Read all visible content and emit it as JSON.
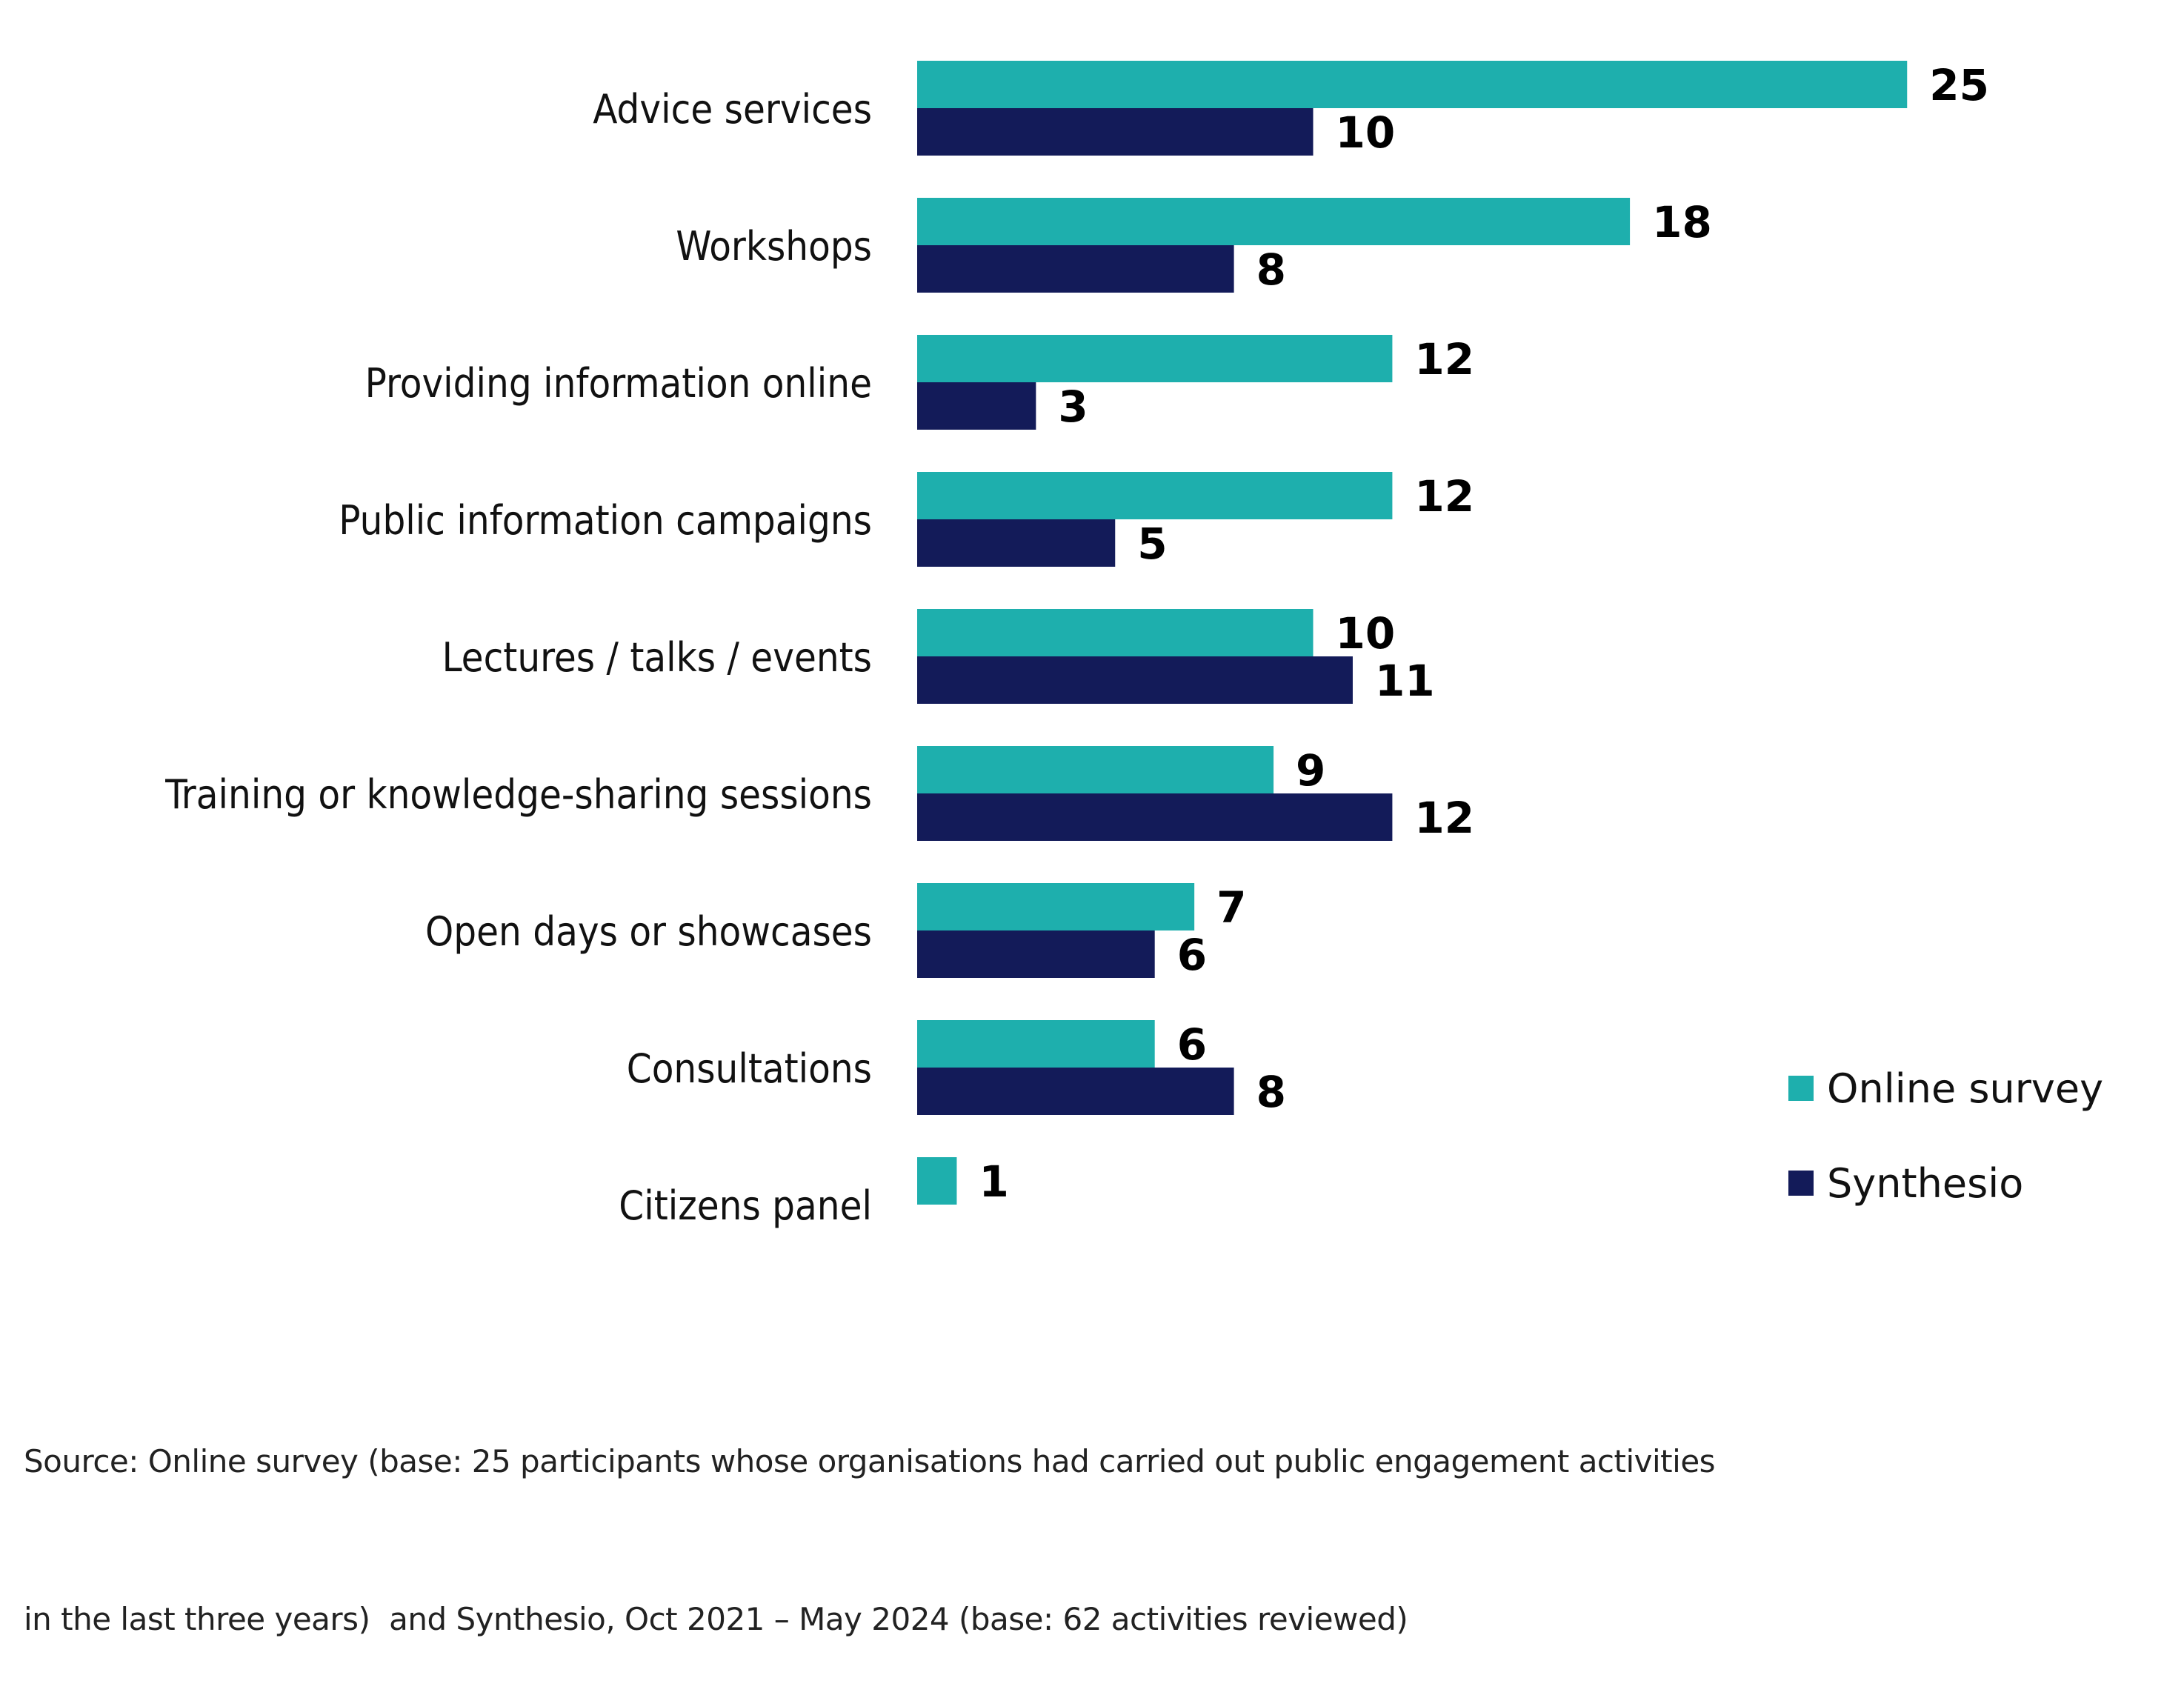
{
  "chart_data": {
    "type": "bar",
    "orientation": "horizontal",
    "title": "",
    "xlabel": "",
    "ylabel": "",
    "categories": [
      "Advice services",
      "Workshops",
      "Providing information online",
      "Public information campaigns",
      "Lectures / talks / events",
      "Training or knowledge-sharing sessions",
      "Open days or showcases",
      "Consultations",
      "Citizens panel"
    ],
    "series": [
      {
        "name": "Online survey",
        "color": "#1eafad",
        "values": [
          25,
          18,
          12,
          12,
          10,
          9,
          7,
          6,
          1
        ]
      },
      {
        "name": "Synthesio",
        "color": "#131b59",
        "values": [
          10,
          8,
          3,
          5,
          11,
          12,
          6,
          8,
          null
        ]
      }
    ],
    "xlim": [
      0,
      25
    ],
    "grid": false,
    "axis_ticks_shown": false,
    "data_labels": true,
    "legend": {
      "position": "bottom-right",
      "entries": [
        "Online survey",
        "Synthesio"
      ]
    }
  },
  "footer": {
    "source_line1": "Source: Online survey (base: 25 participants whose organisations had carried out public engagement activities",
    "source_line2": "in the last three years)  and Synthesio, Oct 2021 – May 2024 (base: 62 activities reviewed)"
  }
}
